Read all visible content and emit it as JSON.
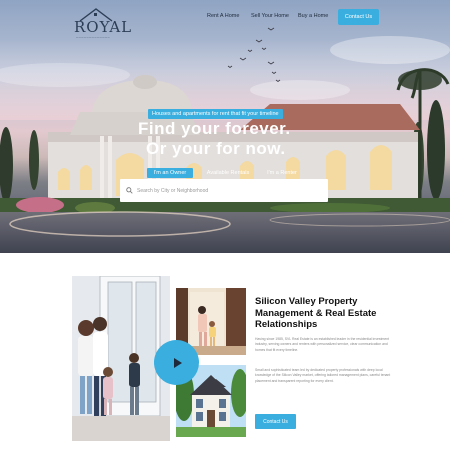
{
  "header": {
    "logo_text": "ROYAL",
    "nav": {
      "rent": "Rent A Home",
      "sell": "Sell Your Home",
      "buy": "Buy a Home"
    },
    "contact_label": "Contact Us"
  },
  "hero": {
    "tagline": "Houses and apartments for rent that fit your timeline",
    "headline_line1": "Find your forever.",
    "headline_line2": "Or your for now.",
    "tabs": [
      "I'm an Owner",
      "Available Rentals",
      "I'm a Renter"
    ],
    "active_tab": "I'm an Owner",
    "search_placeholder": "Search by City or Neighborhood"
  },
  "about": {
    "title": "Silicon Valley Property Management & Real Estate Relationships",
    "paragraph1": "Having since 1985, SVL Real Estate is an established leader in the residential investment industry, serving owners and renters with personalized service, clear communication and homes that fit every timeline.",
    "paragraph2": "Small and sophisticated team led by dedicated property professionals with deep local knowledge of the Silicon Valley market, offering tailored management plans, careful tenant placement and transparent reporting for every client.",
    "contact_label": "Contact Us"
  },
  "colors": {
    "accent": "#3aaedf",
    "heading": "#111111",
    "body_text": "#8a8a8a"
  }
}
